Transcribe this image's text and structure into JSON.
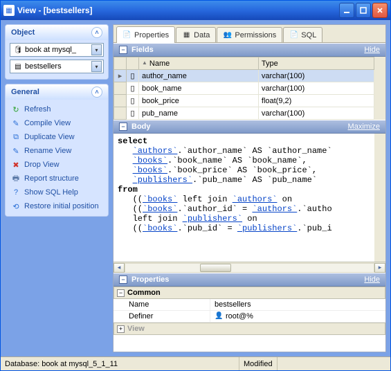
{
  "window": {
    "title": "View - [bestsellers]"
  },
  "object_panel": {
    "title": "Object",
    "combo1": "book at mysql_",
    "combo2": "bestsellers"
  },
  "general_panel": {
    "title": "General",
    "actions": [
      {
        "icon": "↻",
        "color": "#2aa12a",
        "label": "Refresh"
      },
      {
        "icon": "✎",
        "color": "#2a6fd6",
        "label": "Compile View"
      },
      {
        "icon": "⧉",
        "color": "#2a6fd6",
        "label": "Duplicate View"
      },
      {
        "icon": "✎",
        "color": "#2a6fd6",
        "label": "Rename View"
      },
      {
        "icon": "✖",
        "color": "#d0332b",
        "label": "Drop View"
      },
      {
        "icon": "🖶",
        "color": "#5b7aa8",
        "label": "Report structure"
      },
      {
        "icon": "?",
        "color": "#2a6fd6",
        "label": "Show SQL Help"
      },
      {
        "icon": "⟲",
        "color": "#2a6fd6",
        "label": "Restore initial position"
      }
    ]
  },
  "tabs": {
    "properties": "Properties",
    "data": "Data",
    "permissions": "Permissions",
    "sql": "SQL"
  },
  "fields_section": {
    "title": "Fields",
    "link": "Hide",
    "cols": {
      "name": "Name",
      "type": "Type"
    },
    "rows": [
      {
        "name": "author_name",
        "type": "varchar(100)",
        "selected": true
      },
      {
        "name": "book_name",
        "type": "varchar(100)"
      },
      {
        "name": "book_price",
        "type": "float(9,2)"
      },
      {
        "name": "pub_name",
        "type": "varchar(100)"
      }
    ]
  },
  "body_section": {
    "title": "Body",
    "link": "Maximize",
    "sql": {
      "select": "select",
      "l1a": "`authors`",
      "l1b": ".`author_name` AS `author_name`",
      "l2a": "`books`",
      "l2b": ".`book_name` AS `book_name`,",
      "l3a": "`books`",
      "l3b": ".`book_price` AS `book_price`,",
      "l4a": "`publishers`",
      "l4b": ".`pub_name` AS `pub_name`",
      "from": "from",
      "l5a": "((",
      "l5b": "`books`",
      "l5c": " left join ",
      "l5d": "`authors`",
      "l5e": " on",
      "l6a": "((",
      "l6b": "`books`",
      "l6c": ".`author_id` = ",
      "l6d": "`authors`",
      "l6e": ".`autho",
      "l7a": "left join ",
      "l7b": "`publishers`",
      "l7c": " on",
      "l8a": "((",
      "l8b": "`books`",
      "l8c": ".`pub_id` = ",
      "l8d": "`publishers`",
      "l8e": ".`pub_i"
    }
  },
  "properties_section": {
    "title": "Properties",
    "link": "Hide",
    "group_common": "Common",
    "group_view": "View",
    "name_label": "Name",
    "name_value": "bestsellers",
    "definer_label": "Definer",
    "definer_value": "root@%"
  },
  "statusbar": {
    "database": "Database: book at mysql_5_1_11",
    "modified": "Modified"
  }
}
